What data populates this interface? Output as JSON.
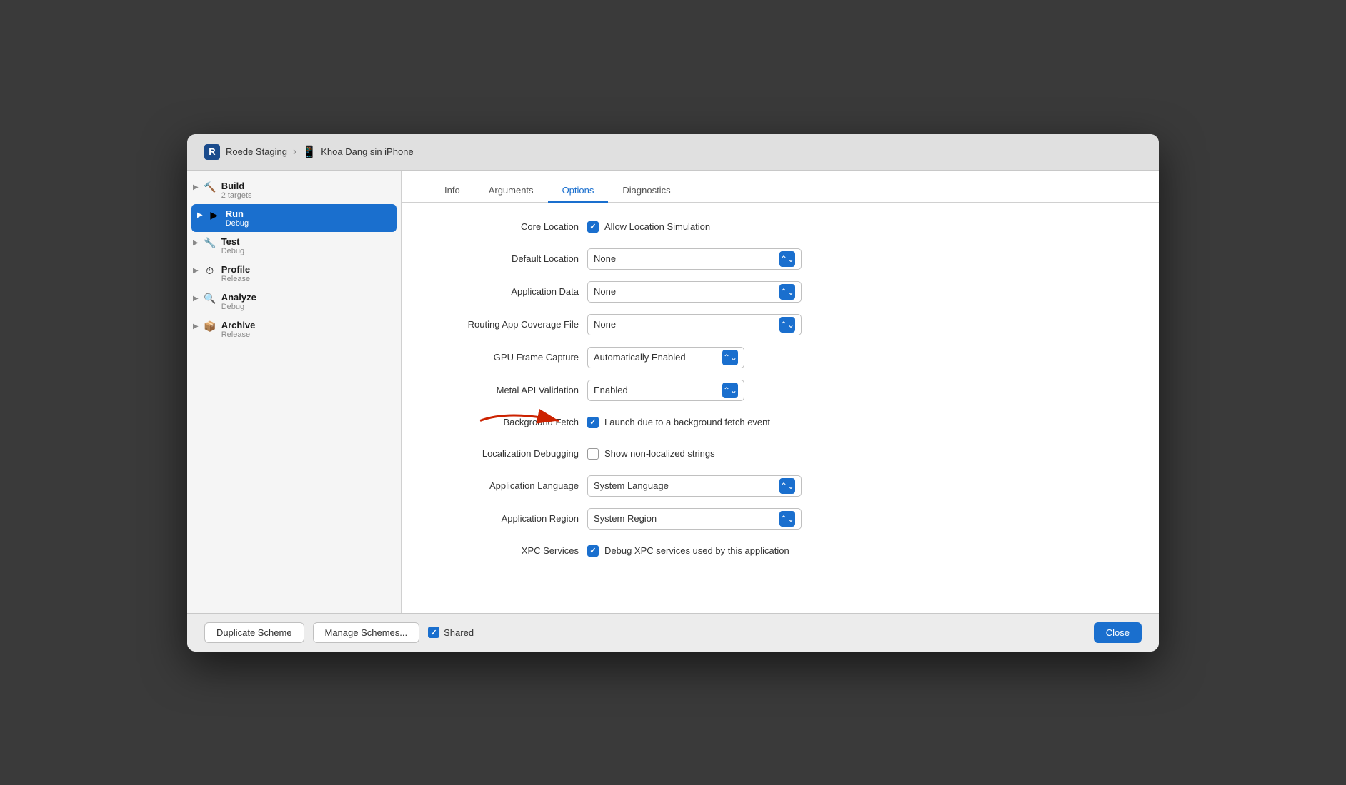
{
  "header": {
    "app_icon": "R",
    "workspace": "Roede Staging",
    "device": "Khoa Dang sin iPhone"
  },
  "sidebar": {
    "items": [
      {
        "id": "build",
        "name": "Build",
        "sub": "2 targets",
        "icon": "🔨",
        "active": false
      },
      {
        "id": "run",
        "name": "Run",
        "sub": "Debug",
        "icon": "▶",
        "active": true
      },
      {
        "id": "test",
        "name": "Test",
        "sub": "Debug",
        "icon": "🔧",
        "active": false
      },
      {
        "id": "profile",
        "name": "Profile",
        "sub": "Release",
        "icon": "⏱",
        "active": false
      },
      {
        "id": "analyze",
        "name": "Analyze",
        "sub": "Debug",
        "icon": "🔍",
        "active": false
      },
      {
        "id": "archive",
        "name": "Archive",
        "sub": "Release",
        "icon": "📦",
        "active": false
      }
    ]
  },
  "tabs": [
    {
      "id": "info",
      "label": "Info",
      "active": false
    },
    {
      "id": "arguments",
      "label": "Arguments",
      "active": false
    },
    {
      "id": "options",
      "label": "Options",
      "active": true
    },
    {
      "id": "diagnostics",
      "label": "Diagnostics",
      "active": false
    }
  ],
  "options": {
    "core_location_label": "Core Location",
    "allow_location_label": "Allow Location Simulation",
    "default_location_label": "Default Location",
    "default_location_value": "None",
    "application_data_label": "Application Data",
    "application_data_value": "None",
    "routing_coverage_label": "Routing App Coverage File",
    "routing_coverage_value": "None",
    "gpu_frame_label": "GPU Frame Capture",
    "gpu_frame_value": "Automatically Enabled",
    "metal_api_label": "Metal API Validation",
    "metal_api_value": "Enabled",
    "background_fetch_label": "Background Fetch",
    "background_fetch_cb_label": "Launch due to a background fetch event",
    "localization_label": "Localization Debugging",
    "localization_cb_label": "Show non-localized strings",
    "app_language_label": "Application Language",
    "app_language_value": "System Language",
    "app_region_label": "Application Region",
    "app_region_value": "System Region",
    "xpc_label": "XPC Services",
    "xpc_cb_label": "Debug XPC services used by this application"
  },
  "footer": {
    "duplicate_label": "Duplicate Scheme",
    "manage_label": "Manage Schemes...",
    "shared_label": "Shared",
    "close_label": "Close"
  }
}
